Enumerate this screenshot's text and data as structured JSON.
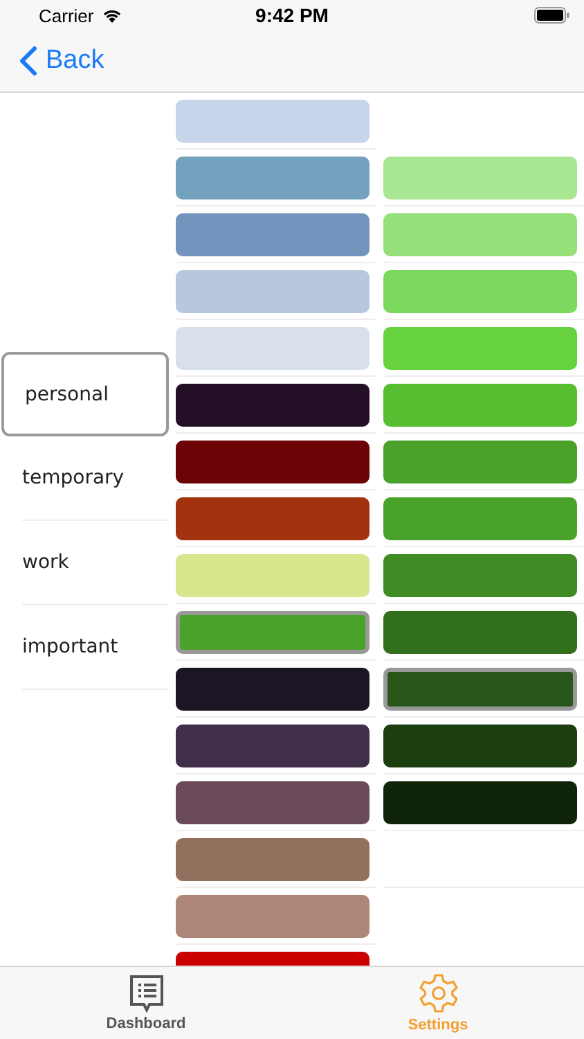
{
  "status_bar": {
    "carrier": "Carrier",
    "time": "9:42 PM"
  },
  "nav": {
    "back": "Back"
  },
  "tags": [
    {
      "label": "personal",
      "selected": true
    },
    {
      "label": "temporary",
      "selected": false
    },
    {
      "label": "work",
      "selected": false
    },
    {
      "label": "important",
      "selected": false
    }
  ],
  "palettes": [
    {
      "swatches": [
        {
          "color": "#c6d5ea",
          "selected": false
        },
        {
          "color": "#74a1bd",
          "selected": false
        },
        {
          "color": "#7395bd",
          "selected": false
        },
        {
          "color": "#b7c8dc",
          "selected": false
        },
        {
          "color": "#d8e0ea",
          "selected": false
        },
        {
          "color": "#241026",
          "selected": false
        },
        {
          "color": "#6c0306",
          "selected": false
        },
        {
          "color": "#a3320e",
          "selected": false
        },
        {
          "color": "#d8e68d",
          "selected": false
        },
        {
          "color": "#4aa22a",
          "selected": true
        },
        {
          "color": "#1c1624",
          "selected": false
        },
        {
          "color": "#3f2f4a",
          "selected": false
        },
        {
          "color": "#6a4959",
          "selected": false
        },
        {
          "color": "#93705d",
          "selected": false
        },
        {
          "color": "#ad8677",
          "selected": false
        },
        {
          "color": "#cc0000",
          "selected": false
        }
      ]
    },
    {
      "swatches": [
        {
          "color": "#aae792",
          "selected": false
        },
        {
          "color": "#96e07a",
          "selected": false
        },
        {
          "color": "#7dd85e",
          "selected": false
        },
        {
          "color": "#66d23e",
          "selected": false
        },
        {
          "color": "#56be30",
          "selected": false
        },
        {
          "color": "#4aa22a",
          "selected": false
        },
        {
          "color": "#49a22a",
          "selected": false
        },
        {
          "color": "#3f8b24",
          "selected": false
        },
        {
          "color": "#32701e",
          "selected": false
        },
        {
          "color": "#29561a",
          "selected": true
        },
        {
          "color": "#1c3f10",
          "selected": false
        },
        {
          "color": "#10240a",
          "selected": false
        }
      ]
    }
  ],
  "tab_bar": [
    {
      "kind": "list",
      "label": "Dashboard",
      "selected": false
    },
    {
      "kind": "gear",
      "label": "Settings",
      "selected": true
    }
  ]
}
